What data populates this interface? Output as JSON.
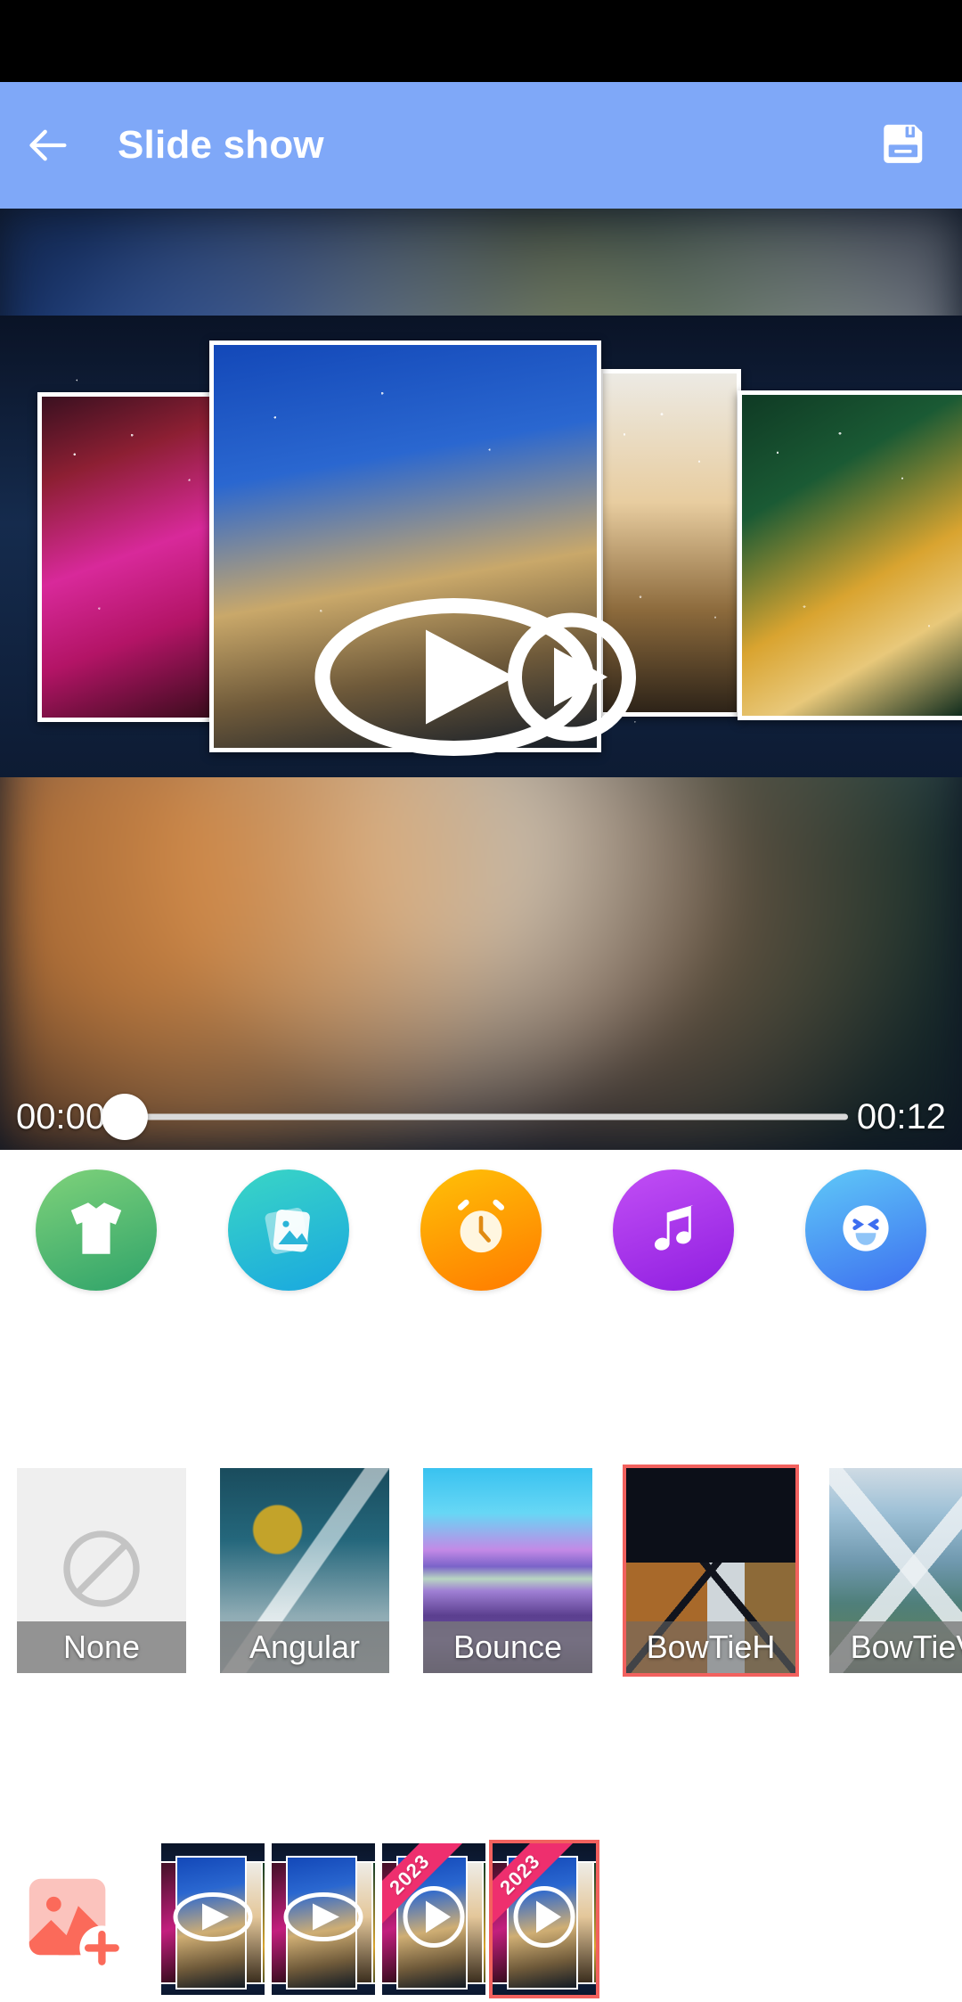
{
  "statusbar": {
    "present": true
  },
  "appbar": {
    "title": "Slide show",
    "back_icon": "arrow-left-icon",
    "save_icon": "floppy-disk-save-icon",
    "background_color": "#7fa8f8"
  },
  "preview": {
    "play_overlay_icon": "play-button-overlay",
    "seek": {
      "current_time": "00:00",
      "total_time": "00:12",
      "progress_percent": 0,
      "track_color": "#d9d9d9",
      "thumb_color": "#ffffff"
    }
  },
  "tools": [
    {
      "name": "theme",
      "icon": "tshirt-icon",
      "color_start": "#7fd27a",
      "color_end": "#2fa36a"
    },
    {
      "name": "photos",
      "icon": "photos-icon",
      "color_start": "#3ad6c5",
      "color_end": "#19a7e0"
    },
    {
      "name": "duration",
      "icon": "alarm-clock-icon",
      "color_start": "#ffc107",
      "color_end": "#ff7a00"
    },
    {
      "name": "music",
      "icon": "music-note-icon",
      "color_start": "#c24ff5",
      "color_end": "#8f1ee0"
    },
    {
      "name": "sticker",
      "icon": "emoji-sticker-icon",
      "color_start": "#5fc9f8",
      "color_end": "#3d6ef0"
    }
  ],
  "transitions": {
    "selected": "BowTieH",
    "selected_border_color": "#f2615e",
    "items": [
      {
        "label": "None",
        "thumb": "thumb-none",
        "icon": "no-entry-icon",
        "selected": false
      },
      {
        "label": "Angular",
        "thumb": "thumb-angular",
        "icon": "",
        "selected": false
      },
      {
        "label": "Bounce",
        "thumb": "thumb-bounce",
        "icon": "",
        "selected": false
      },
      {
        "label": "BowTieH",
        "thumb": "thumb-bowtieh",
        "icon": "",
        "selected": true
      },
      {
        "label": "BowTieV",
        "thumb": "thumb-bowtiev",
        "icon": "",
        "selected": false
      }
    ]
  },
  "filmstrip": {
    "add_button_icon": "add-photo-icon",
    "selected_index": 3,
    "selected_border_color": "#f2615e",
    "clips": [
      {
        "ribbon": "",
        "play_icon": "play-icon",
        "selected": false
      },
      {
        "ribbon": "",
        "play_icon": "play-icon",
        "selected": false
      },
      {
        "ribbon": "2023",
        "play_icon": "play-icon",
        "selected": false
      },
      {
        "ribbon": "2023",
        "play_icon": "play-icon",
        "selected": true
      }
    ]
  }
}
